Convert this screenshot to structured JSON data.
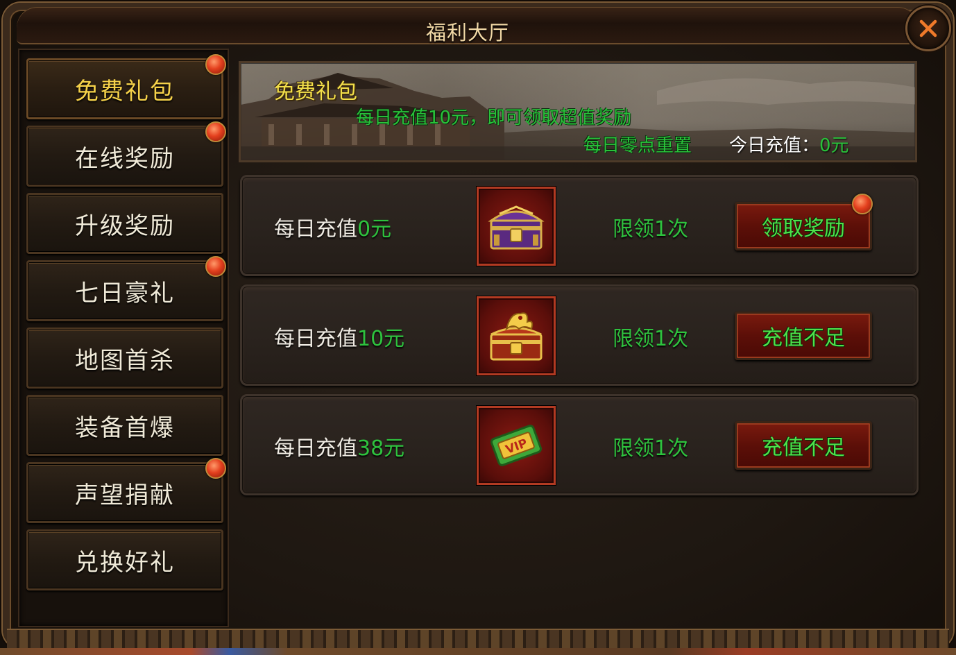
{
  "window": {
    "title": "福利大厅",
    "close_icon": "close-icon"
  },
  "sidebar": {
    "items": [
      {
        "label": "免费礼包",
        "active": true,
        "badge": true
      },
      {
        "label": "在线奖励",
        "active": false,
        "badge": true
      },
      {
        "label": "升级奖励",
        "active": false,
        "badge": false
      },
      {
        "label": "七日豪礼",
        "active": false,
        "badge": true
      },
      {
        "label": "地图首杀",
        "active": false,
        "badge": false
      },
      {
        "label": "装备首爆",
        "active": false,
        "badge": false
      },
      {
        "label": "声望捐献",
        "active": false,
        "badge": true
      },
      {
        "label": "兑换好礼",
        "active": false,
        "badge": false
      }
    ]
  },
  "banner": {
    "title": "免费礼包",
    "subtitle": "每日充值10元，即可领取超值奖励",
    "reset_note": "每日零点重置",
    "today_label": "今日充值：",
    "today_value": "0元"
  },
  "rewards": [
    {
      "label": "每日充值",
      "amount": "0元",
      "item_icon": "purple-treasure-chest-icon",
      "limit": "限领1次",
      "button": "领取奖励",
      "badge": true
    },
    {
      "label": "每日充值",
      "amount": "10元",
      "item_icon": "golden-dragon-chest-icon",
      "limit": "限领1次",
      "button": "充值不足",
      "badge": false
    },
    {
      "label": "每日充值",
      "amount": "38元",
      "item_icon": "vip-card-icon",
      "limit": "限领1次",
      "button": "充值不足",
      "badge": false
    }
  ],
  "colors": {
    "accent_gold": "#f6d24a",
    "accent_green": "#2ec23e",
    "button_red": "#5c0f08",
    "badge_red": "#e4401e"
  }
}
